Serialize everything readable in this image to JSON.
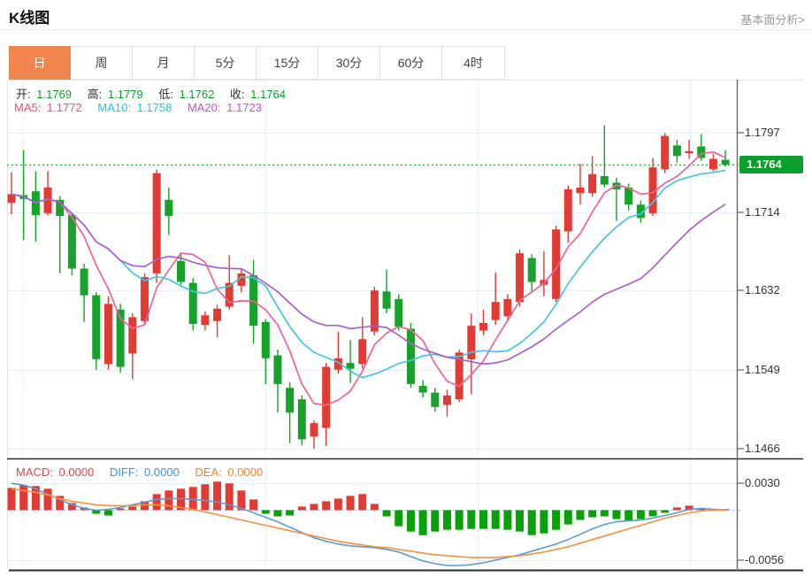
{
  "header": {
    "title": "K线图",
    "link": "基本面分析>"
  },
  "tabs": [
    {
      "key": "day",
      "label": "日",
      "active": true
    },
    {
      "key": "week",
      "label": "周",
      "active": false
    },
    {
      "key": "month",
      "label": "月",
      "active": false
    },
    {
      "key": "5min",
      "label": "5分",
      "active": false
    },
    {
      "key": "15min",
      "label": "15分",
      "active": false
    },
    {
      "key": "30min",
      "label": "30分",
      "active": false
    },
    {
      "key": "60min",
      "label": "60分",
      "active": false
    },
    {
      "key": "4hour",
      "label": "4时",
      "active": false
    }
  ],
  "ohlc_legend": {
    "open_label": "开:",
    "open": "1.1769",
    "high_label": "高:",
    "high": "1.1779",
    "low_label": "低:",
    "low": "1.1762",
    "close_label": "收:",
    "close": "1.1764"
  },
  "ma_legend": {
    "ma5_label": "MA5:",
    "ma5": "1.1772",
    "ma10_label": "MA10:",
    "ma10": "1.1758",
    "ma20_label": "MA20:",
    "ma20": "1.1723"
  },
  "macd_legend": {
    "macd_label": "MACD:",
    "macd": "0.0000",
    "diff_label": "DIFF:",
    "diff": "0.0000",
    "dea_label": "DEA:",
    "dea": "0.0000"
  },
  "colors": {
    "up": "#e23b34",
    "down": "#16a22b",
    "hist_pos": "#e23b34",
    "hist_neg": "#0aa00a",
    "ma5": "#ef6398",
    "ma10": "#43c6e0",
    "ma20": "#ab5fc8",
    "diff_line": "#5b9bd5",
    "dea_line": "#f5923e",
    "price_line": "#3bb54a",
    "price_tag_bg": "#0a9e2d",
    "ohlc_value": "#0ba32e",
    "macd_text": "#e64545",
    "diff_text": "#3d94e8",
    "dea_text": "#f58220",
    "ma5_text": "#f14d75",
    "ma10_text": "#25c0e8",
    "ma20_text": "#c455d6",
    "grid": "#e9eff7",
    "axis": "#666666",
    "dark_border": "#2b2b2b",
    "light_border": "#e5e5e5",
    "zero_dash": "#b8d4ee",
    "tab_active_bg": "#f0854e"
  },
  "chart_data": [
    {
      "type": "candlestick",
      "timeframe": "日",
      "convention": "red=up green=down",
      "ylim": [
        1.1456,
        1.1853
      ],
      "y_ticks": [
        {
          "value": 1.1797,
          "label": "1.1797"
        },
        {
          "value": 1.1714,
          "label": "1.1714"
        },
        {
          "value": 1.1632,
          "label": "1.1632"
        },
        {
          "value": 1.1549,
          "label": "1.1549"
        },
        {
          "value": 1.1466,
          "label": "1.1466"
        }
      ],
      "price_line": {
        "value": 1.1764,
        "label": "1.1764"
      },
      "vgrid_x": [
        25,
        300,
        540,
        780
      ],
      "overlays": [
        {
          "name": "MA5",
          "period": 5
        },
        {
          "name": "MA10",
          "period": 10
        },
        {
          "name": "MA20",
          "period": 20
        }
      ],
      "candles": [
        [
          1.1724,
          1.1756,
          1.1712,
          1.1733
        ],
        [
          1.1732,
          1.1779,
          1.1685,
          1.1728
        ],
        [
          1.1736,
          1.1757,
          1.1683,
          1.1711
        ],
        [
          1.1713,
          1.1757,
          1.1711,
          1.174
        ],
        [
          1.1727,
          1.1731,
          1.165,
          1.171
        ],
        [
          1.1711,
          1.1713,
          1.1648,
          1.1655
        ],
        [
          1.1655,
          1.166,
          1.1599,
          1.1627
        ],
        [
          1.1627,
          1.163,
          1.1549,
          1.156
        ],
        [
          1.1555,
          1.1626,
          1.1549,
          1.1618
        ],
        [
          1.1612,
          1.1618,
          1.1546,
          1.1552
        ],
        [
          1.1566,
          1.1608,
          1.1539,
          1.1604
        ],
        [
          1.16,
          1.165,
          1.1596,
          1.1646
        ],
        [
          1.165,
          1.1759,
          1.164,
          1.1755
        ],
        [
          1.1727,
          1.174,
          1.169,
          1.171
        ],
        [
          1.1663,
          1.167,
          1.1638,
          1.1641
        ],
        [
          1.164,
          1.1645,
          1.159,
          1.1597
        ],
        [
          1.1596,
          1.161,
          1.159,
          1.1606
        ],
        [
          1.16,
          1.1617,
          1.1583,
          1.1613
        ],
        [
          1.1615,
          1.1669,
          1.1612,
          1.164
        ],
        [
          1.1637,
          1.1655,
          1.163,
          1.165
        ],
        [
          1.1648,
          1.1664,
          1.1576,
          1.1595
        ],
        [
          1.1599,
          1.1602,
          1.1534,
          1.1561
        ],
        [
          1.1564,
          1.157,
          1.1504,
          1.1534
        ],
        [
          1.153,
          1.1536,
          1.1472,
          1.1504
        ],
        [
          1.1518,
          1.1522,
          1.147,
          1.1476
        ],
        [
          1.1479,
          1.1496,
          1.1466,
          1.1493
        ],
        [
          1.1488,
          1.1556,
          1.1469,
          1.1552
        ],
        [
          1.1549,
          1.1589,
          1.1545,
          1.1561
        ],
        [
          1.1556,
          1.158,
          1.1535,
          1.155
        ],
        [
          1.1555,
          1.1604,
          1.155,
          1.1581
        ],
        [
          1.1589,
          1.1636,
          1.1585,
          1.1632
        ],
        [
          1.1631,
          1.1654,
          1.1608,
          1.1613
        ],
        [
          1.1623,
          1.1628,
          1.159,
          1.1594
        ],
        [
          1.1592,
          1.1598,
          1.153,
          1.1534
        ],
        [
          1.1532,
          1.1538,
          1.152,
          1.1525
        ],
        [
          1.1525,
          1.153,
          1.1505,
          1.151
        ],
        [
          1.1512,
          1.1528,
          1.15,
          1.1522
        ],
        [
          1.1518,
          1.157,
          1.1515,
          1.1567
        ],
        [
          1.156,
          1.1608,
          1.1523,
          1.1595
        ],
        [
          1.159,
          1.1612,
          1.1585,
          1.1598
        ],
        [
          1.1601,
          1.1651,
          1.1596,
          1.162
        ],
        [
          1.1605,
          1.1628,
          1.16,
          1.1623
        ],
        [
          1.162,
          1.1675,
          1.1615,
          1.1671
        ],
        [
          1.1666,
          1.167,
          1.163,
          1.1641
        ],
        [
          1.1638,
          1.1673,
          1.1626,
          1.1643
        ],
        [
          1.1623,
          1.17,
          1.162,
          1.1696
        ],
        [
          1.1694,
          1.1742,
          1.1682,
          1.1738
        ],
        [
          1.1734,
          1.1765,
          1.1722,
          1.174
        ],
        [
          1.1734,
          1.1773,
          1.173,
          1.1754
        ],
        [
          1.1752,
          1.1805,
          1.174,
          1.1743
        ],
        [
          1.1745,
          1.175,
          1.1705,
          1.1738
        ],
        [
          1.174,
          1.1744,
          1.1716,
          1.1722
        ],
        [
          1.1722,
          1.1726,
          1.1703,
          1.1708
        ],
        [
          1.1713,
          1.1771,
          1.171,
          1.1761
        ],
        [
          1.1759,
          1.1797,
          1.1755,
          1.1794
        ],
        [
          1.1784,
          1.179,
          1.1766,
          1.1773
        ],
        [
          1.1776,
          1.179,
          1.177,
          1.1778
        ],
        [
          1.1783,
          1.1796,
          1.1768,
          1.1771
        ],
        [
          1.1759,
          1.1775,
          1.1757,
          1.177
        ],
        [
          1.1769,
          1.1779,
          1.1762,
          1.1764
        ]
      ]
    },
    {
      "type": "macd",
      "ylim": [
        -0.0066,
        0.0057
      ],
      "y_ticks": [
        {
          "value": 0.003,
          "label": "0.0030"
        },
        {
          "value": -0.0056,
          "label": "-0.0056"
        }
      ],
      "zero_dashed_line": true,
      "histogram": [
        0.0025,
        0.0028,
        0.0027,
        0.0024,
        0.0016,
        0.0008,
        0.0003,
        -0.0004,
        -0.0006,
        0.0002,
        0.0004,
        0.001,
        0.0018,
        0.0022,
        0.0024,
        0.0026,
        0.0029,
        0.0032,
        0.003,
        0.0022,
        0.0012,
        -0.0004,
        -0.0007,
        -0.0006,
        0.0004,
        0.0007,
        0.001,
        0.0013,
        0.0016,
        0.0018,
        0.0007,
        -0.0007,
        -0.0018,
        -0.0024,
        -0.0028,
        -0.0024,
        -0.0022,
        -0.0022,
        -0.0021,
        -0.0021,
        -0.0021,
        -0.0022,
        -0.0024,
        -0.0028,
        -0.0026,
        -0.0022,
        -0.0016,
        -0.0011,
        -0.0008,
        -0.0007,
        -0.001,
        -0.0012,
        -0.001,
        -0.0007,
        -0.0003,
        0.0003,
        0.0005,
        0.0002,
        0.0001,
        0.0
      ],
      "diff": [
        0.003,
        0.0028,
        0.0024,
        0.0018,
        0.0012,
        0.0006,
        0.0002,
        0.0,
        0.0001,
        0.0003,
        0.0006,
        0.0009,
        0.0012,
        0.0013,
        0.0013,
        0.0012,
        0.0011,
        0.0009,
        0.0006,
        0.0002,
        -0.0003,
        -0.0008,
        -0.0013,
        -0.0019,
        -0.0025,
        -0.0031,
        -0.0035,
        -0.0038,
        -0.004,
        -0.0041,
        -0.0042,
        -0.0044,
        -0.0047,
        -0.0052,
        -0.0057,
        -0.006,
        -0.0062,
        -0.0062,
        -0.0061,
        -0.0059,
        -0.0056,
        -0.0053,
        -0.005,
        -0.0046,
        -0.0042,
        -0.0038,
        -0.0033,
        -0.0027,
        -0.0021,
        -0.0016,
        -0.0013,
        -0.0012,
        -0.0011,
        -0.0009,
        -0.0006,
        -0.0003,
        0.0001,
        0.0002,
        0.0001,
        0.0
      ],
      "dea": [
        0.0024,
        0.0022,
        0.002,
        0.0017,
        0.0013,
        0.001,
        0.0008,
        0.0006,
        0.0005,
        0.0005,
        0.0005,
        0.0006,
        0.0006,
        0.0005,
        0.0003,
        0.0001,
        -0.0002,
        -0.0005,
        -0.0008,
        -0.0011,
        -0.0014,
        -0.0017,
        -0.002,
        -0.0023,
        -0.0026,
        -0.0029,
        -0.0032,
        -0.0035,
        -0.0037,
        -0.0039,
        -0.0041,
        -0.0042,
        -0.0044,
        -0.0046,
        -0.0048,
        -0.005,
        -0.0051,
        -0.0052,
        -0.0053,
        -0.0053,
        -0.0053,
        -0.0052,
        -0.0051,
        -0.0049,
        -0.0047,
        -0.0044,
        -0.0041,
        -0.0037,
        -0.0033,
        -0.0029,
        -0.0025,
        -0.0021,
        -0.0017,
        -0.0013,
        -0.0009,
        -0.0006,
        -0.0003,
        -0.0001,
        0.0,
        0.0
      ]
    }
  ]
}
